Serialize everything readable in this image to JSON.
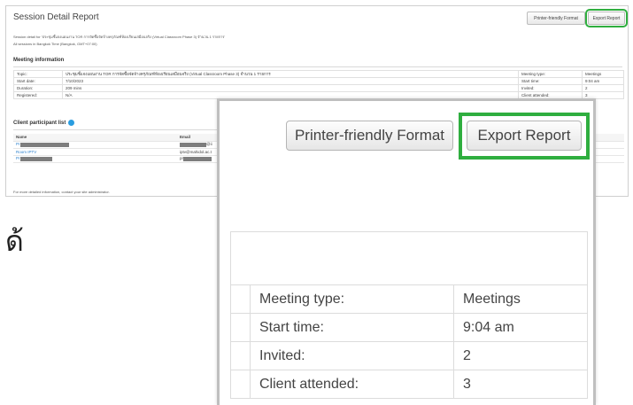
{
  "report": {
    "title": "Session Detail Report",
    "print_label": "Printer-friendly Format",
    "export_label": "Export Report",
    "session_line": "Session detail for 'ประชุมชี้แจงแผนงาน TOR การจัดซื้อจัดจ้างครุภัณฑ์ห้องเรียนเสมือนจริง (Virtual Classroom Phase 3) จำนวน 1 รายการ'",
    "timezone_line": "All sessions in Bangkok Time (Bangkok, GMT+07:00)",
    "meeting_section": "Meeting information",
    "meeting_rows": [
      {
        "k": "Topic:",
        "v": "ประชุมชี้แจงแผนงาน TOR การจัดซื้อจัดจ้างครุภัณฑ์ห้องเรียนเสมือนจริง (Virtual Classroom Phase 3) จำนวน 1 รายการ",
        "k2": "Meeting type:",
        "v2": "Meetings"
      },
      {
        "k": "Start date:",
        "v": "7/10/2023",
        "k2": "Start time:",
        "v2": "9:04 am"
      },
      {
        "k": "Duration:",
        "v": "209 mins",
        "k2": "Invited:",
        "v2": "2"
      },
      {
        "k": "Registered:",
        "v": "N/A",
        "k2": "Client attended:",
        "v2": "3"
      }
    ],
    "client_section": "Client participant list",
    "client_headers": {
      "name": "Name",
      "email": "Email"
    },
    "clients": [
      {
        "name": "Pr",
        "email": "@ii"
      },
      {
        "name": "Room IPTV",
        "email": "iptv@mahidol.ac.t"
      },
      {
        "name": "Pr",
        "email": "pr"
      }
    ],
    "footer": "For more detailed information, contact your site administrator."
  },
  "thai_glyph": "ด้",
  "zoom": {
    "print_label": "Printer-friendly Format",
    "export_label": "Export Report",
    "rows": [
      {
        "label": "Meeting type:",
        "value": "Meetings"
      },
      {
        "label": "Start time:",
        "value": "9:04 am"
      },
      {
        "label": "Invited:",
        "value": "2"
      },
      {
        "label": "Client attended:",
        "value": "3"
      }
    ]
  },
  "colors": {
    "highlight": "#2fae3f",
    "link": "#2a7fcc",
    "info": "#2a9de0"
  }
}
